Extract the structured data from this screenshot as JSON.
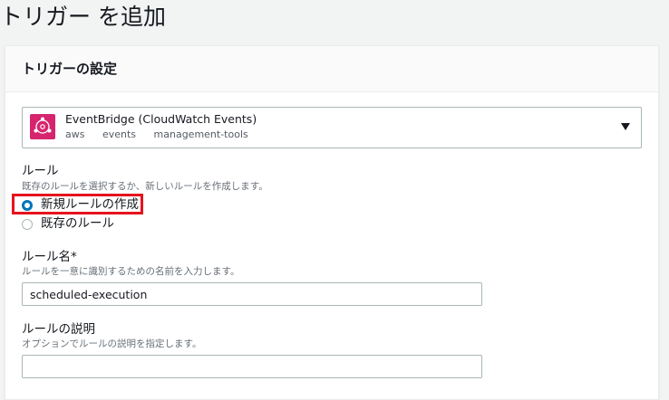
{
  "page": {
    "title": "トリガー を追加"
  },
  "panel": {
    "header_title": "トリガーの設定"
  },
  "service_select": {
    "name": "EventBridge (CloudWatch Events)",
    "tags": [
      "aws",
      "events",
      "management-tools"
    ],
    "icon": "eventbridge-icon",
    "icon_color": "#d6246e"
  },
  "rule": {
    "label": "ルール",
    "description": "既存のルールを選択するか、新しいルールを作成します。",
    "options": [
      {
        "label": "新規ルールの作成",
        "selected": true
      },
      {
        "label": "既存のルール",
        "selected": false
      }
    ]
  },
  "rule_name": {
    "label": "ルール名*",
    "description": "ルールを一意に識別するための名前を入力します。",
    "value": "scheduled-execution"
  },
  "rule_description": {
    "label": "ルールの説明",
    "description": "オプションでルールの説明を指定します。",
    "value": ""
  },
  "colors": {
    "accent": "#0073bb",
    "highlight": "#e5131d"
  }
}
